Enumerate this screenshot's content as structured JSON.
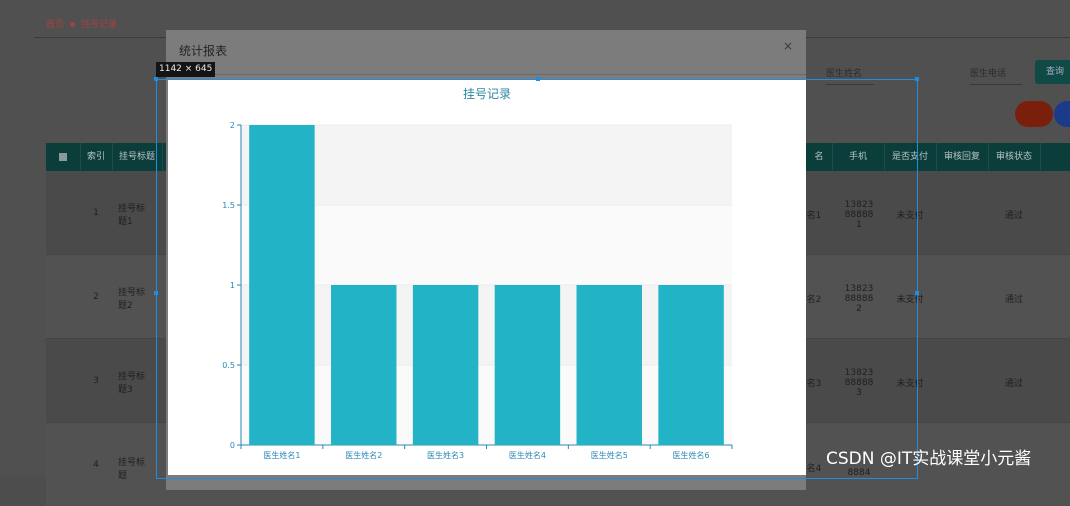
{
  "breadcrumb": {
    "home": "首页",
    "current": "挂号记录"
  },
  "toolbar": {
    "search_field_1": "医生姓名",
    "search_field_2": "医生电话",
    "query_button": "查询"
  },
  "table": {
    "headers": [
      "索引",
      "挂号标题",
      "名",
      "手机",
      "是否支付",
      "审核回复",
      "审核状态"
    ],
    "rows": [
      {
        "index": "1",
        "title": "挂号标题1",
        "name_suffix": "名1",
        "phone": "13823888881",
        "paid": "未支付",
        "status": "通过"
      },
      {
        "index": "2",
        "title": "挂号标题2",
        "name_suffix": "名2",
        "phone": "13823888882",
        "paid": "未支付",
        "status": "通过"
      },
      {
        "index": "3",
        "title": "挂号标题3",
        "name_suffix": "名3",
        "phone": "13823888883",
        "paid": "未支付",
        "status": "通过"
      },
      {
        "index": "4",
        "title": "挂号标题",
        "name_suffix": "名4",
        "phone": "8884",
        "paid": "",
        "status": ""
      }
    ]
  },
  "modal": {
    "title": "统计报表",
    "close": "×"
  },
  "size_tag": "1142 × 645",
  "watermark": "CSDN @IT实战课堂小元酱",
  "colors": {
    "bar": "#22b3c7",
    "title": "#2c87a6",
    "axis": "#2b89b6"
  },
  "chart_data": {
    "type": "bar",
    "title": "挂号记录",
    "categories": [
      "医生姓名1",
      "医生姓名2",
      "医生姓名3",
      "医生姓名4",
      "医生姓名5",
      "医生姓名6"
    ],
    "values": [
      2,
      1,
      1,
      1,
      1,
      1
    ],
    "yticks": [
      "0",
      "0.5",
      "1",
      "1.5",
      "2"
    ],
    "ylim": [
      0,
      2
    ],
    "xlabel": "",
    "ylabel": "",
    "grid": true,
    "legend": "none"
  }
}
